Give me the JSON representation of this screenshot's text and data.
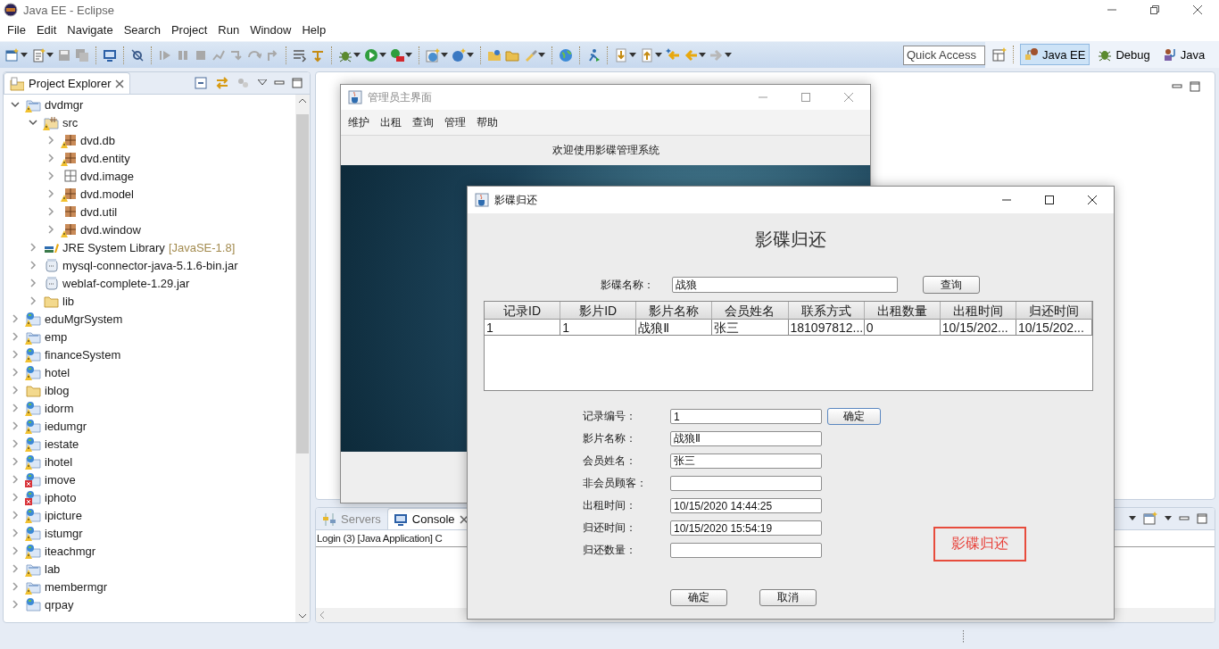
{
  "window": {
    "title": "Java EE - Eclipse"
  },
  "menu": [
    "File",
    "Edit",
    "Navigate",
    "Search",
    "Project",
    "Run",
    "Window",
    "Help"
  ],
  "toolbar": {
    "quick_access": {
      "placeholder": "Quick Access"
    },
    "perspectives": [
      {
        "label": "Java EE",
        "selected": true,
        "kind": "javaee"
      },
      {
        "label": "Debug",
        "selected": false,
        "kind": "debug"
      },
      {
        "label": "Java",
        "selected": false,
        "kind": "java"
      }
    ]
  },
  "project_explorer": {
    "title": "Project Explorer",
    "tree": [
      {
        "label": "dvdmgr",
        "kind": "project",
        "warning": true,
        "error": false,
        "expanded": true,
        "children": [
          {
            "label": "src",
            "kind": "source-folder",
            "warning": true,
            "error": false,
            "expanded": true,
            "children": [
              {
                "label": "dvd.db",
                "kind": "package",
                "warning": true,
                "error": false,
                "expanded": false
              },
              {
                "label": "dvd.entity",
                "kind": "package",
                "warning": true,
                "error": false,
                "expanded": false
              },
              {
                "label": "dvd.image",
                "kind": "empty-package",
                "warning": false,
                "error": false,
                "expanded": false
              },
              {
                "label": "dvd.model",
                "kind": "package",
                "warning": true,
                "error": false,
                "expanded": false
              },
              {
                "label": "dvd.util",
                "kind": "package",
                "warning": false,
                "error": false,
                "expanded": false
              },
              {
                "label": "dvd.window",
                "kind": "package",
                "warning": true,
                "error": false,
                "expanded": false
              }
            ]
          },
          {
            "label": "JRE System Library",
            "decoration": "[JavaSE-1.8]",
            "kind": "library",
            "warning": false,
            "error": false,
            "expanded": false
          },
          {
            "label": "mysql-connector-java-5.1.6-bin.jar",
            "kind": "jar",
            "warning": false,
            "error": false,
            "expanded": false
          },
          {
            "label": "weblaf-complete-1.29.jar",
            "kind": "jar",
            "warning": false,
            "error": false,
            "expanded": false
          },
          {
            "label": "lib",
            "kind": "folder",
            "warning": false,
            "error": false,
            "expanded": false
          }
        ]
      },
      {
        "label": "eduMgrSystem",
        "kind": "web-project",
        "warning": true,
        "error": false,
        "expanded": false
      },
      {
        "label": "emp",
        "kind": "project",
        "warning": true,
        "error": false,
        "expanded": false
      },
      {
        "label": "financeSystem",
        "kind": "web-project",
        "warning": true,
        "error": false,
        "expanded": false
      },
      {
        "label": "hotel",
        "kind": "web-project",
        "warning": true,
        "error": false,
        "expanded": false
      },
      {
        "label": "iblog",
        "kind": "folder",
        "warning": false,
        "error": false,
        "expanded": false
      },
      {
        "label": "idorm",
        "kind": "web-project",
        "warning": true,
        "error": false,
        "expanded": false
      },
      {
        "label": "iedumgr",
        "kind": "web-project",
        "warning": true,
        "error": false,
        "expanded": false
      },
      {
        "label": "iestate",
        "kind": "web-project",
        "warning": true,
        "error": false,
        "expanded": false
      },
      {
        "label": "ihotel",
        "kind": "web-project",
        "warning": true,
        "error": false,
        "expanded": false
      },
      {
        "label": "imove",
        "kind": "web-project",
        "warning": false,
        "error": true,
        "expanded": false
      },
      {
        "label": "iphoto",
        "kind": "web-project",
        "warning": false,
        "error": true,
        "expanded": false
      },
      {
        "label": "ipicture",
        "kind": "web-project",
        "warning": true,
        "error": false,
        "expanded": false
      },
      {
        "label": "istumgr",
        "kind": "web-project",
        "warning": true,
        "error": false,
        "expanded": false
      },
      {
        "label": "iteachmgr",
        "kind": "web-project",
        "warning": true,
        "error": false,
        "expanded": false
      },
      {
        "label": "lab",
        "kind": "project",
        "warning": true,
        "error": false,
        "expanded": false
      },
      {
        "label": "membermgr",
        "kind": "project",
        "warning": true,
        "error": false,
        "expanded": false
      },
      {
        "label": "qrpay",
        "kind": "web-project",
        "warning": false,
        "error": false,
        "expanded": false
      }
    ]
  },
  "console": {
    "tabs": [
      {
        "label": "Servers",
        "selected": false,
        "kind": "servers"
      },
      {
        "label": "Console",
        "selected": true,
        "kind": "console"
      }
    ],
    "text": "Login (3) [Java Application] C"
  },
  "admin_window": {
    "title": "管理员主界面",
    "menu": [
      "维护",
      "出租",
      "查询",
      "管理",
      "帮助"
    ],
    "welcome": "欢迎使用影碟管理系统"
  },
  "return_dialog": {
    "title": "影碟归还",
    "heading": "影碟归还",
    "search": {
      "label": "影碟名称：",
      "value": "战狼",
      "button": "查询"
    },
    "table": {
      "columns": [
        "记录ID",
        "影片ID",
        "影片名称",
        "会员姓名",
        "联系方式",
        "出租数量",
        "出租时间",
        "归还时间"
      ],
      "rows": [
        [
          "1",
          "1",
          "战狼Ⅱ",
          "张三",
          "181097812...",
          "0",
          "10/15/202...",
          "10/15/202..."
        ]
      ]
    },
    "form": [
      {
        "label": "记录编号：",
        "value": "1",
        "kind": "field-button",
        "button": "确定"
      },
      {
        "label": "影片名称：",
        "value": "战狼Ⅱ",
        "kind": "field"
      },
      {
        "label": "会员姓名：",
        "value": "张三",
        "kind": "field"
      },
      {
        "label": "非会员顾客：",
        "kind": "field"
      },
      {
        "label": "出租时间：",
        "value": "10/15/2020 14:44:25",
        "kind": "field"
      },
      {
        "label": "归还时间：",
        "value": "10/15/2020 15:54:19",
        "kind": "field"
      },
      {
        "label": "归还数量：",
        "kind": "field"
      }
    ],
    "side_label": "影碟归还",
    "buttons": [
      "确定",
      "取消"
    ]
  }
}
